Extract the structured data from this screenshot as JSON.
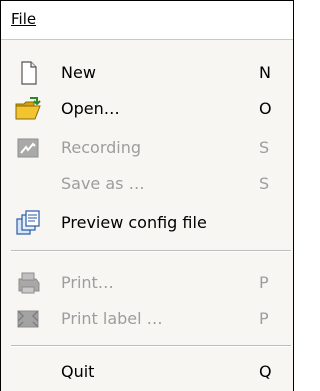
{
  "menubar": {
    "title": "File"
  },
  "menu": {
    "items": [
      {
        "label": "New",
        "shortcut": "N",
        "enabled": true,
        "icon": "new-document-icon"
      },
      {
        "label": "Open…",
        "shortcut": "O",
        "enabled": true,
        "icon": "open-folder-icon"
      },
      {
        "label": "Recording",
        "shortcut": "S",
        "enabled": false,
        "icon": "recording-icon"
      },
      {
        "label": "Save as …",
        "shortcut": "S",
        "enabled": false,
        "icon": ""
      },
      {
        "label": "Preview config file",
        "shortcut": "",
        "enabled": true,
        "icon": "preview-copy-icon"
      },
      {
        "label": "Print…",
        "shortcut": "P",
        "enabled": false,
        "icon": "printer-icon"
      },
      {
        "label": "Print label …",
        "shortcut": "P",
        "enabled": false,
        "icon": "print-label-icon"
      },
      {
        "label": "Quit",
        "shortcut": "Q",
        "enabled": true,
        "icon": ""
      }
    ]
  }
}
